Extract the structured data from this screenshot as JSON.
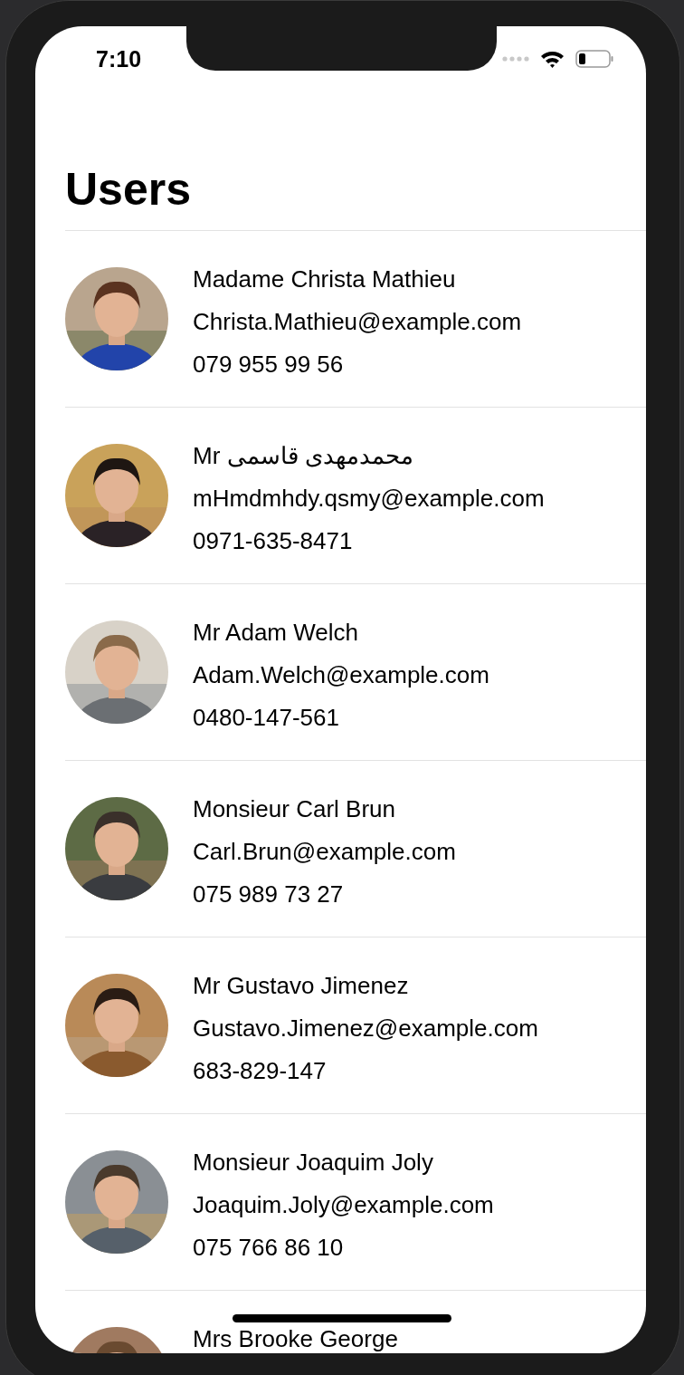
{
  "status_bar": {
    "time": "7:10"
  },
  "title": "Users",
  "users": [
    {
      "name": "Madame Christa Mathieu",
      "email": "Christa.Mathieu@example.com",
      "phone": "079 955 99 56"
    },
    {
      "name": "Mr محمدمهدی قاسمی",
      "email": "mHmdmhdy.qsmy@example.com",
      "phone": "0971-635-8471"
    },
    {
      "name": "Mr Adam Welch",
      "email": "Adam.Welch@example.com",
      "phone": "0480-147-561"
    },
    {
      "name": "Monsieur Carl Brun",
      "email": "Carl.Brun@example.com",
      "phone": "075 989 73 27"
    },
    {
      "name": "Mr Gustavo Jimenez",
      "email": "Gustavo.Jimenez@example.com",
      "phone": "683-829-147"
    },
    {
      "name": "Monsieur Joaquim Joly",
      "email": "Joaquim.Joly@example.com",
      "phone": "075 766 86 10"
    },
    {
      "name": "Mrs Brooke George"
    }
  ]
}
